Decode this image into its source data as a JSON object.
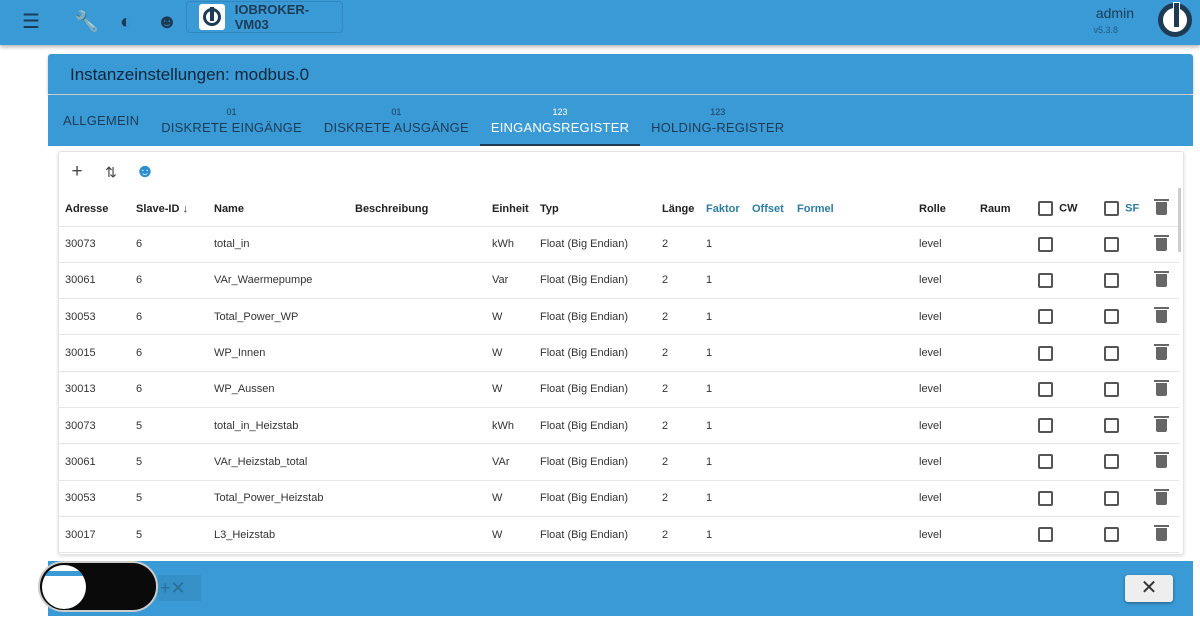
{
  "topbar": {
    "host": "IOBROKER-VM03",
    "user": "admin",
    "version": "v5.3.8"
  },
  "panel": {
    "title": "Instanzeinstellungen: modbus.0",
    "tabs": [
      {
        "badge": "",
        "label": "Allgemein"
      },
      {
        "badge": "01",
        "label": "Diskrete Eingänge"
      },
      {
        "badge": "01",
        "label": "Diskrete Ausgänge"
      },
      {
        "badge": "123",
        "label": "Eingangsregister"
      },
      {
        "badge": "123",
        "label": "Holding-Register"
      }
    ],
    "active_tab": "Eingangsregister"
  },
  "table": {
    "headers": {
      "adresse": "Adresse",
      "slave": "Slave-ID",
      "name": "Name",
      "beschreibung": "Beschreibung",
      "einheit": "Einheit",
      "typ": "Typ",
      "laenge": "Länge",
      "faktor": "Faktor",
      "offset": "Offset",
      "formel": "Formel",
      "rolle": "Rolle",
      "raum": "Raum",
      "cw": "CW",
      "sf": "SF"
    },
    "rows": [
      {
        "adresse": "30073",
        "slave": "6",
        "name": "total_in",
        "einheit": "kWh",
        "typ": "Float (Big Endian)",
        "laenge": "2",
        "faktor": "1",
        "rolle": "level"
      },
      {
        "adresse": "30061",
        "slave": "6",
        "name": "VAr_Waermepumpe",
        "einheit": "Var",
        "typ": "Float (Big Endian)",
        "laenge": "2",
        "faktor": "1",
        "rolle": "level"
      },
      {
        "adresse": "30053",
        "slave": "6",
        "name": "Total_Power_WP",
        "einheit": "W",
        "typ": "Float (Big Endian)",
        "laenge": "2",
        "faktor": "1",
        "rolle": "level"
      },
      {
        "adresse": "30015",
        "slave": "6",
        "name": "WP_Innen",
        "einheit": "W",
        "typ": "Float (Big Endian)",
        "laenge": "2",
        "faktor": "1",
        "rolle": "level"
      },
      {
        "adresse": "30013",
        "slave": "6",
        "name": "WP_Aussen",
        "einheit": "W",
        "typ": "Float (Big Endian)",
        "laenge": "2",
        "faktor": "1",
        "rolle": "level"
      },
      {
        "adresse": "30073",
        "slave": "5",
        "name": "total_in_Heizstab",
        "einheit": "kWh",
        "typ": "Float (Big Endian)",
        "laenge": "2",
        "faktor": "1",
        "rolle": "level"
      },
      {
        "adresse": "30061",
        "slave": "5",
        "name": "VAr_Heizstab_total",
        "einheit": "VAr",
        "typ": "Float (Big Endian)",
        "laenge": "2",
        "faktor": "1",
        "rolle": "level"
      },
      {
        "adresse": "30053",
        "slave": "5",
        "name": "Total_Power_Heizstab",
        "einheit": "W",
        "typ": "Float (Big Endian)",
        "laenge": "2",
        "faktor": "1",
        "rolle": "level"
      },
      {
        "adresse": "30017",
        "slave": "5",
        "name": "L3_Heizstab",
        "einheit": "W",
        "typ": "Float (Big Endian)",
        "laenge": "2",
        "faktor": "1",
        "rolle": "level"
      }
    ]
  },
  "footer": {
    "close": "✕"
  }
}
